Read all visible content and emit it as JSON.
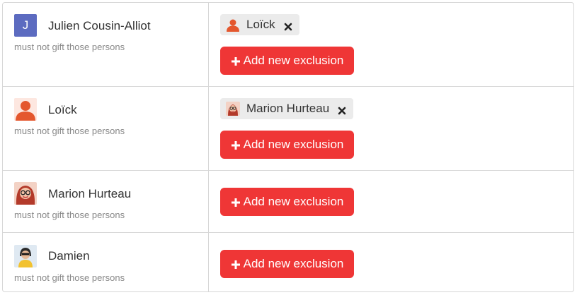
{
  "rows": [
    {
      "name": "Julien Cousin-Alliot",
      "avatar_letter": "J",
      "hint": "must not gift those persons",
      "exclusions": [
        {
          "name": "Loïck"
        }
      ],
      "add_label": "Add new exclusion"
    },
    {
      "name": "Loïck",
      "hint": "must not gift those persons",
      "exclusions": [
        {
          "name": "Marion Hurteau"
        }
      ],
      "add_label": "Add new exclusion"
    },
    {
      "name": "Marion Hurteau",
      "hint": "must not gift those persons",
      "exclusions": [],
      "add_label": "Add new exclusion"
    },
    {
      "name": "Damien",
      "hint": "must not gift those persons",
      "exclusions": [],
      "add_label": "Add new exclusion"
    }
  ],
  "colors": {
    "accent": "#ef3636",
    "letter_avatar": "#5c6bc0",
    "chip_bg": "#ebebeb",
    "hint_text": "#888888",
    "border": "#d7d7d7"
  }
}
